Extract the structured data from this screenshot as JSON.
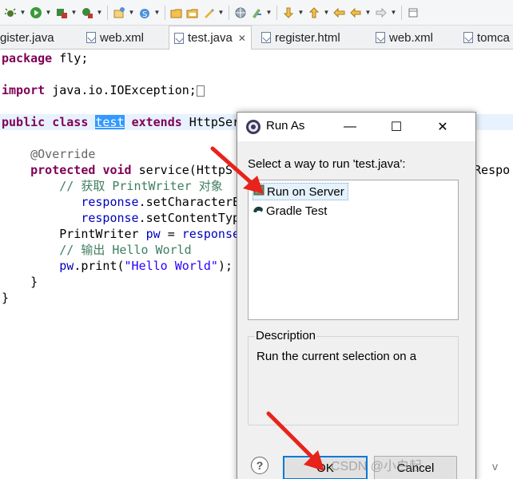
{
  "toolbar": {
    "buttons": [
      {
        "icon": "debug-icon",
        "dropdown": true
      },
      {
        "icon": "run-icon",
        "dropdown": true
      },
      {
        "icon": "coverage-icon",
        "dropdown": true
      },
      {
        "icon": "external-tools-icon",
        "dropdown": true
      },
      {
        "icon": "new-java-project-icon",
        "dropdown": true
      },
      {
        "icon": "new-java-package-icon",
        "dropdown": true
      },
      {
        "icon": "open-type-icon",
        "dropdown": false
      },
      {
        "icon": "open-folder-icon",
        "dropdown": false
      },
      {
        "icon": "open-task-icon",
        "dropdown": true
      },
      {
        "icon": "browser-icon",
        "dropdown": false
      },
      {
        "icon": "edit-marker-icon",
        "dropdown": true
      },
      {
        "icon": "next-annotation-icon",
        "dropdown": true
      },
      {
        "icon": "previous-annotation-icon",
        "dropdown": true
      },
      {
        "icon": "last-edit-location-icon",
        "dropdown": false
      },
      {
        "icon": "back-icon",
        "dropdown": true
      },
      {
        "icon": "forward-icon",
        "dropdown": true
      },
      {
        "icon": "pin-editor-icon",
        "dropdown": false
      }
    ]
  },
  "tabs": [
    {
      "label": "gister.java",
      "active": false,
      "icon": "java-file-icon"
    },
    {
      "label": "web.xml",
      "active": false,
      "icon": "xml-file-icon"
    },
    {
      "label": "test.java",
      "active": true,
      "icon": "java-file-icon"
    },
    {
      "label": "register.html",
      "active": false,
      "icon": "html-file-icon"
    },
    {
      "label": "web.xml",
      "active": false,
      "icon": "xml-file-icon"
    },
    {
      "label": "tomca",
      "active": false,
      "icon": "xml-file-icon"
    }
  ],
  "code": {
    "l1_kw": "package",
    "l1_rest": " fly;",
    "l2_kw": "import",
    "l2_rest": " java.io.IOException;",
    "l3_kw1": "public",
    "l3_kw2": "class",
    "l3_sel": "test",
    "l3_kw3": "extends",
    "l3_rest": " HttpSer",
    "l4_ann": "@Override",
    "l5_kw1": "protected",
    "l5_kw2": "void",
    "l5_rest": " service(HttpS",
    "l5_tail": "tRespo",
    "l6_cm": "// 获取 PrintWriter 对象",
    "l7_fld": "response",
    "l7_rest": ".setCharacterE",
    "l8_fld": "response",
    "l8_rest": ".setContentTyp",
    "l9_a": "PrintWriter ",
    "l9_fld": "pw",
    "l9_b": " = ",
    "l9_fld2": "response",
    "l10_cm": "// 输出 Hello World",
    "l11_fld": "pw",
    "l11_a": ".print(",
    "l11_str": "\"Hello World\"",
    "l11_b": ");",
    "l12": "}",
    "l13": "}"
  },
  "dialog": {
    "title": "Run As",
    "minimize": "—",
    "maximize": "☐",
    "close": "✕",
    "prompt": "Select a way to run 'test.java':",
    "options": [
      {
        "label": "Run on Server",
        "icon": "server-run-icon",
        "selected": true
      },
      {
        "label": "Gradle Test",
        "icon": "gradle-icon",
        "selected": false
      }
    ],
    "description_label": "Description",
    "description_text": "Run the current selection on a",
    "help": "?",
    "ok": "OK",
    "cancel": "Cancel"
  },
  "watermark": "CSDN @小白起",
  "margin_mark": "v",
  "colors": {
    "keyword": "#7f0055",
    "comment": "#3f7f5f",
    "field": "#0000c0",
    "string": "#2a00ff",
    "selection": "#3399ff",
    "arrow": "#e8231b",
    "ok_border": "#0078d7"
  }
}
